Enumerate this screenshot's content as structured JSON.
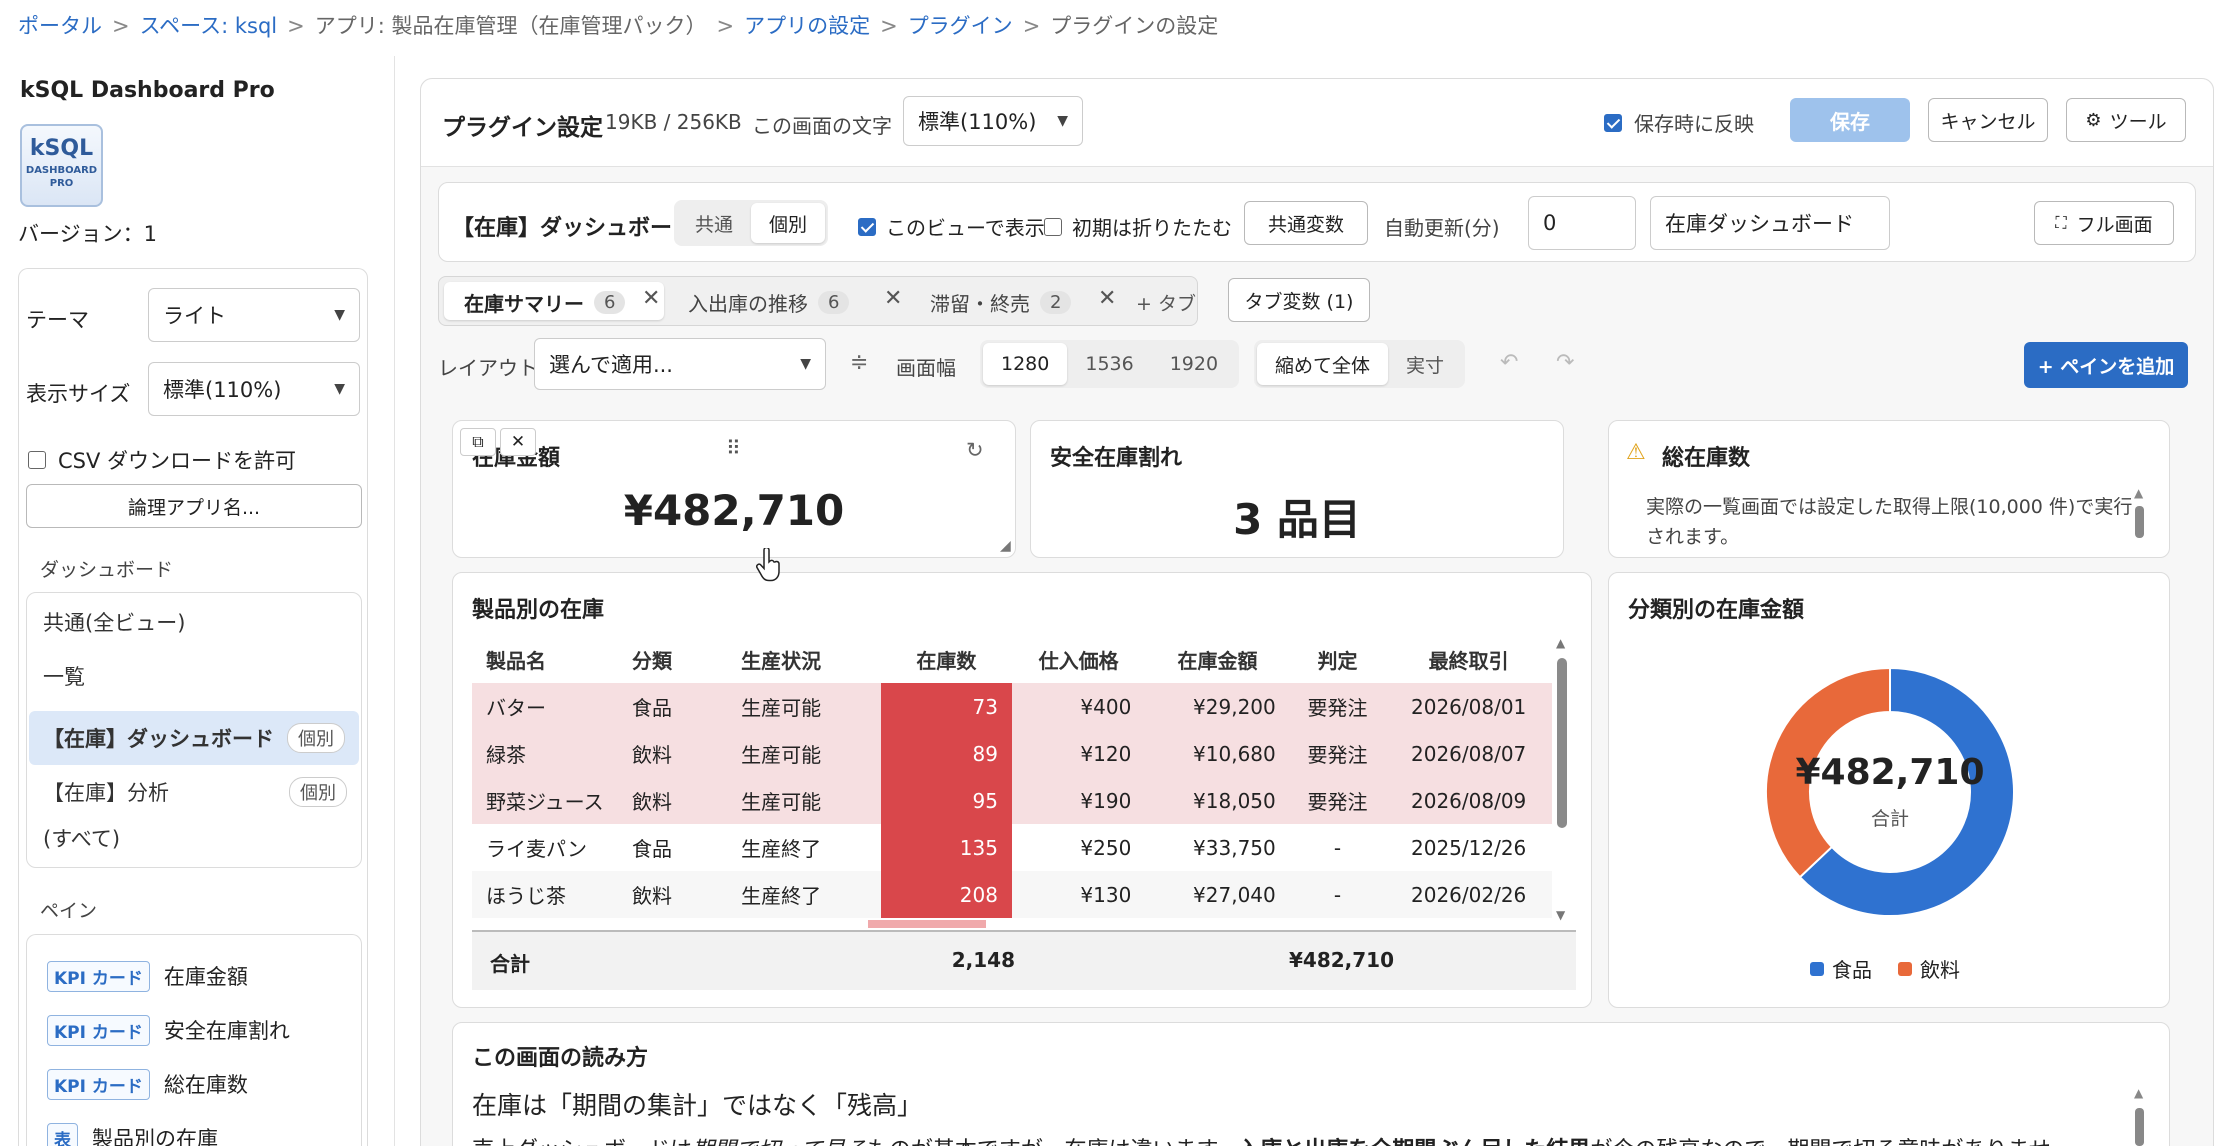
{
  "breadcrumb": {
    "portal": "ポータル",
    "space": "スペース: ksql",
    "app": "アプリ: 製品在庫管理（在庫管理パック）",
    "settings": "アプリの設定",
    "plugin": "プラグイン",
    "current": "プラグインの設定",
    "sep": ">"
  },
  "sidebar": {
    "title": "kSQL Dashboard Pro",
    "logo_main": "kSQL",
    "logo_sub1": "DASHBOARD",
    "logo_sub2": "PRO",
    "version": "バージョン：1",
    "theme_label": "テーマ",
    "theme_value": "ライト",
    "size_label": "表示サイズ",
    "size_value": "標準(110%)",
    "csv_label": "CSV ダウンロードを許可",
    "logical_button": "論理アプリ名...",
    "dash_heading": "ダッシュボード",
    "dash_items": [
      {
        "label": "共通(全ビュー)",
        "badge": ""
      },
      {
        "label": "一覧",
        "badge": ""
      },
      {
        "label": "【在庫】ダッシュボード",
        "badge": "個別"
      },
      {
        "label": "【在庫】分析",
        "badge": "個別"
      },
      {
        "label": "(すべて)",
        "badge": ""
      }
    ],
    "pane_heading": "ペイン",
    "panes": [
      {
        "tag": "KPI カード",
        "label": "在庫金額"
      },
      {
        "tag": "KPI カード",
        "label": "安全在庫割れ"
      },
      {
        "tag": "KPI カード",
        "label": "総在庫数"
      },
      {
        "tag": "表",
        "label": "製品別の在庫"
      }
    ]
  },
  "toolbar": {
    "title": "プラグイン設定",
    "size": "19KB / 256KB",
    "font_label": "この画面の文字",
    "font_value": "標準(110%)",
    "reflect_label": "保存時に反映",
    "save": "保存",
    "cancel": "キャンセル",
    "tools": "ツール"
  },
  "view": {
    "name": "【在庫】ダッシュボード",
    "seg_common": "共通",
    "seg_individual": "個別",
    "show_label": "このビューで表示",
    "collapse_label": "初期は折りたたむ",
    "common_vars": "共通変数",
    "refresh_label": "自動更新(分)",
    "refresh_value": "0",
    "title_value": "在庫ダッシュボード",
    "fullscreen": "フル画面"
  },
  "tabs": [
    {
      "label": "在庫サマリー",
      "count": "6"
    },
    {
      "label": "入出庫の推移",
      "count": "6"
    },
    {
      "label": "滞留・終売",
      "count": "2"
    }
  ],
  "add_tab": "+ タブ",
  "tab_vars": "タブ変数 (1)",
  "layout": {
    "label": "レイアウト",
    "select": "選んで適用...",
    "width_label": "画面幅",
    "widths": [
      "1280",
      "1536",
      "1920"
    ],
    "fit": "縮めて全体",
    "actual": "実寸",
    "add_pane": "+ ペインを追加"
  },
  "kpis": [
    {
      "title": "在庫金額",
      "value": "¥482,710"
    },
    {
      "title": "安全在庫割れ",
      "value": "3 品目"
    },
    {
      "title": "総在庫数",
      "note": "実際の一覧画面では設定した取得上限(10,000 件)で実行されます。"
    }
  ],
  "table": {
    "title": "製品別の在庫",
    "headers": [
      "製品名",
      "分類",
      "生産状況",
      "在庫数",
      "仕入価格",
      "在庫金額",
      "判定",
      "最終取引"
    ],
    "rows": [
      [
        "バター",
        "食品",
        "生産可能",
        "73",
        "¥400",
        "¥29,200",
        "要発注",
        "2026/08/01"
      ],
      [
        "緑茶",
        "飲料",
        "生産可能",
        "89",
        "¥120",
        "¥10,680",
        "要発注",
        "2026/08/07"
      ],
      [
        "野菜ジュース",
        "飲料",
        "生産可能",
        "95",
        "¥190",
        "¥18,050",
        "要発注",
        "2026/08/09"
      ],
      [
        "ライ麦パン",
        "食品",
        "生産終了",
        "135",
        "¥250",
        "¥33,750",
        "-",
        "2025/12/26"
      ],
      [
        "ほうじ茶",
        "飲料",
        "生産終了",
        "208",
        "¥130",
        "¥27,040",
        "-",
        "2026/02/26"
      ]
    ],
    "total_label": "合計",
    "total_qty": "2,148",
    "total_amount": "¥482,710"
  },
  "donut": {
    "title": "分類別の在庫金額",
    "center": "¥482,710",
    "center_sub": "合計"
  },
  "chart_data": {
    "type": "pie",
    "title": "分類別の在庫金額",
    "categories": [
      "食品",
      "飲料"
    ],
    "values": [
      62.95,
      37.05
    ],
    "colors": [
      "#2f72d0",
      "#e8693a"
    ],
    "legend": "bottom"
  },
  "readme": {
    "title": "この画面の読み方",
    "subtitle": "在庫は「期間の集計」ではなく「残高」",
    "body_a": "売上ダッシュボードは",
    "body_b": "期間で切って見る",
    "body_c": "ものが基本ですが、在庫は違います。",
    "body_d": "入庫と出庫を全期間ぶん足した結果",
    "body_e": "が今の残高なので、期間で切る意味がありませ"
  }
}
